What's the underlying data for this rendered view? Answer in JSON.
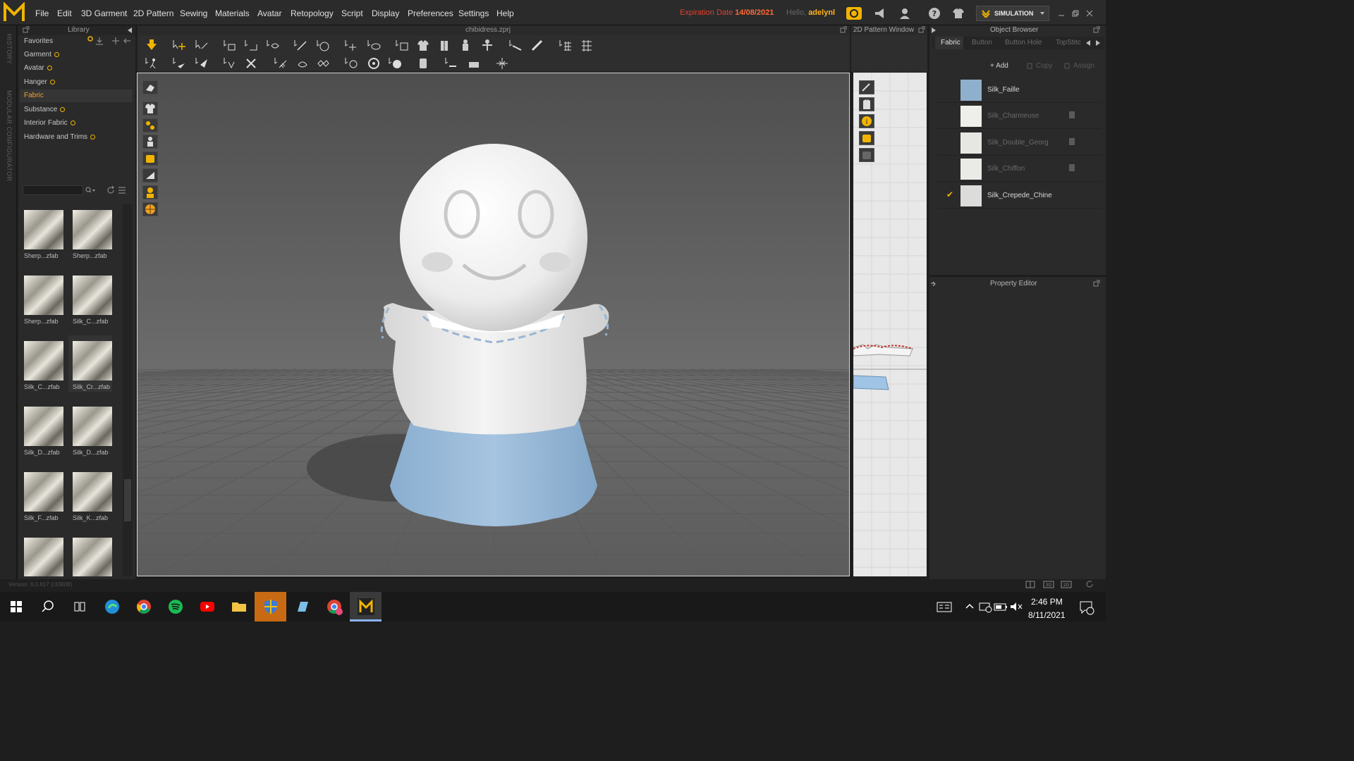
{
  "menu": {
    "items": [
      "File",
      "Edit",
      "3D Garment",
      "2D Pattern",
      "Sewing",
      "Materials",
      "Avatar",
      "Retopology",
      "Script",
      "Display",
      "Preferences",
      "Settings",
      "Help"
    ]
  },
  "account": {
    "expiry_label": "Expiration Date",
    "expiry_date": "14/08/2021",
    "hello_label": "Hello,",
    "username": "adelynl"
  },
  "mode": {
    "label": "SIMULATION"
  },
  "side_strip": {
    "history": "HISTORY",
    "modular": "MODULAR CONFIGURATOR"
  },
  "library": {
    "title": "Library",
    "items": [
      {
        "label": "Favorites"
      },
      {
        "label": "Garment"
      },
      {
        "label": "Avatar"
      },
      {
        "label": "Hanger"
      },
      {
        "label": "Fabric"
      },
      {
        "label": "Substance"
      },
      {
        "label": "Interior Fabric"
      },
      {
        "label": "Hardware and Trims"
      }
    ],
    "thumbnails": [
      "Sherp...zfab",
      "Sherp...zfab",
      "Sherp...zfab",
      "Silk_C...zfab",
      "Silk_C...zfab",
      "Silk_Cr...zfab",
      "Silk_D...zfab",
      "Silk_D...zfab",
      "Silk_F...zfab",
      "Silk_K...zfab",
      "",
      ""
    ]
  },
  "window3d": {
    "filename": "chibidress.zprj"
  },
  "window2d": {
    "title": "2D Pattern Window"
  },
  "object_browser": {
    "title": "Object Browser",
    "tabs": [
      "Fabric",
      "Button",
      "Button Hole",
      "TopStitc"
    ],
    "buttons": {
      "add": "+ Add",
      "copy": "Copy",
      "assign": "Assign"
    },
    "fabrics": [
      {
        "name": "Silk_Faille",
        "color": "#8fb0cc",
        "active": true,
        "checked": false
      },
      {
        "name": "Silk_Charmeuse",
        "color": "#eeeeea",
        "active": false,
        "checked": false
      },
      {
        "name": "Silk_Double_Georg",
        "color": "#e6e6e2",
        "active": false,
        "checked": false
      },
      {
        "name": "Silk_Chiffon",
        "color": "#eaeae6",
        "active": false,
        "checked": false
      },
      {
        "name": "Silk_Crepede_Chine",
        "color": "#dcdcda",
        "active": true,
        "checked": true
      }
    ]
  },
  "property_editor": {
    "title": "Property Editor"
  },
  "status": {
    "version": "Version: 6.0.617 (r33808)"
  },
  "taskbar": {
    "time": "2:46 PM",
    "date": "8/11/2021"
  },
  "colors": {
    "accent": "#f0b400",
    "expiry": "#e04030",
    "dress_blue": "#9fbfdc"
  }
}
